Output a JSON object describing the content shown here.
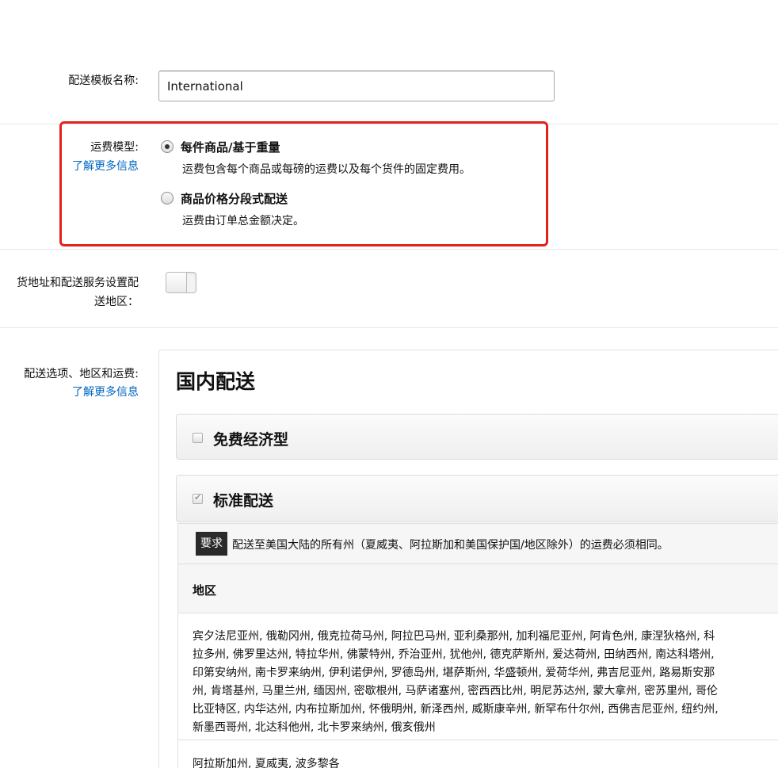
{
  "template_name": {
    "label": "配送模板名称:",
    "value": "International"
  },
  "shipping_model": {
    "label": "运费模型:",
    "learn_more": "了解更多信息",
    "options": [
      {
        "title": "每件商品/基于重量",
        "description": "运费包含每个商品或每磅的运费以及每个货件的固定费用。",
        "selected": true
      },
      {
        "title": "商品价格分段式配送",
        "description": "运费由订单总金额决定。",
        "selected": false
      }
    ],
    "highlight_color": "#e3231b"
  },
  "ship_from": {
    "label_line1": "货地址和配送服务设置配",
    "label_line2": "送地区：",
    "enabled": false
  },
  "shipping_options": {
    "label": "配送选项、地区和运费:",
    "learn_more": "了解更多信息",
    "panel_title": "国内配送",
    "methods": [
      {
        "title": "免费经济型",
        "checked": false
      },
      {
        "title": "标准配送",
        "checked": true
      }
    ],
    "requirement_badge": "要求",
    "requirement_text": "配送至美国大陆的所有州（夏威夷、阿拉斯加和美国保护国/地区除外）的运费必须相同。",
    "region_header": "地区",
    "regions_lines": [
      "宾夕法尼亚州, 俄勒冈州, 俄克拉荷马州, 阿拉巴马州, 亚利桑那州, 加利福尼亚州, 阿肯色州, 康涅狄格州, 科",
      "拉多州, 佛罗里达州, 特拉华州, 佛蒙特州, 乔治亚州, 犹他州, 德克萨斯州, 爱达荷州, 田纳西州, 南达科塔州,",
      "印第安纳州, 南卡罗来纳州, 伊利诺伊州, 罗德岛州, 堪萨斯州, 华盛顿州, 爱荷华州, 弗吉尼亚州, 路易斯安那",
      "州, 肯塔基州, 马里兰州, 缅因州, 密歇根州, 马萨诸塞州, 密西西比州, 明尼苏达州, 蒙大拿州, 密苏里州, 哥伦",
      "比亚特区, 内华达州, 内布拉斯加州, 怀俄明州, 新泽西州, 威斯康辛州, 新罕布什尔州, 西佛吉尼亚州, 纽约州,",
      "新墨西哥州, 北达科他州, 北卡罗来纳州, 俄亥俄州"
    ],
    "second_region": "阿拉斯加州, 夏威夷, 波多黎各"
  },
  "colors": {
    "link": "#0066c0",
    "badge_bg": "#2a2a2a"
  }
}
